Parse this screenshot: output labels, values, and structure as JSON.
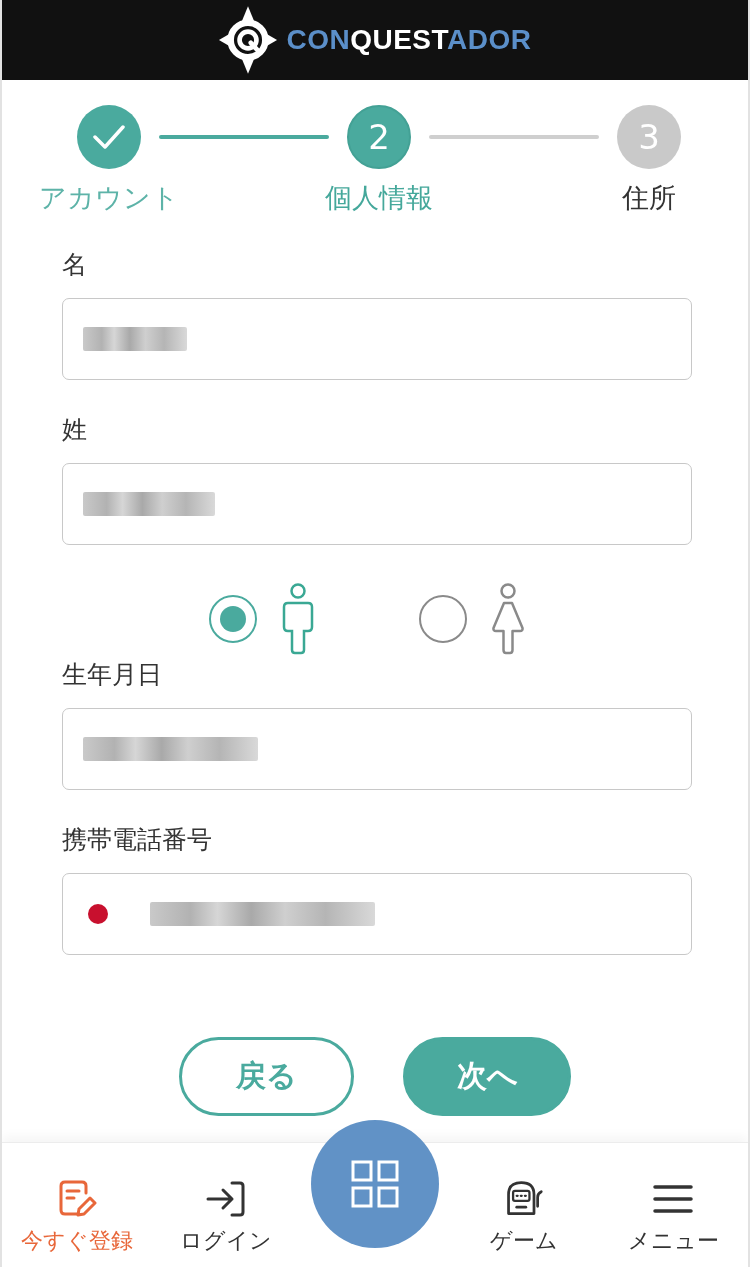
{
  "header": {
    "logo": [
      {
        "text": "CON",
        "accent": true
      },
      {
        "text": "QUEST",
        "accent": false
      },
      {
        "text": "ADOR",
        "accent": true
      }
    ]
  },
  "steps": [
    {
      "label": "アカウント",
      "completed": true,
      "current": false
    },
    {
      "label": "個人情報",
      "number": "2",
      "completed": false,
      "current": true
    },
    {
      "label": "住所",
      "number": "3",
      "completed": false,
      "current": false
    }
  ],
  "form": [
    {
      "kind": "text",
      "label": "名",
      "redacted": true
    },
    {
      "kind": "text",
      "label": "姓",
      "redacted": true
    },
    {
      "kind": "gender",
      "options": [
        {
          "kind": "male",
          "selected": true
        },
        {
          "kind": "female",
          "selected": false
        }
      ]
    },
    {
      "kind": "text",
      "label": "生年月日",
      "redacted": true
    },
    {
      "kind": "phone",
      "label": "携帯電話番号",
      "redacted": true
    }
  ],
  "buttons": [
    {
      "label": "戻る",
      "kind": "secondary"
    },
    {
      "label": "次へ",
      "kind": "primary"
    }
  ],
  "bottom_nav": [
    {
      "kind": "tab",
      "label": "今すぐ登録",
      "highlighted": true
    },
    {
      "kind": "tab",
      "label": "ログイン",
      "highlighted": false
    },
    {
      "kind": "center"
    },
    {
      "kind": "tab",
      "label": "ゲーム",
      "highlighted": false
    },
    {
      "kind": "tab",
      "label": "メニュー",
      "highlighted": false
    }
  ]
}
